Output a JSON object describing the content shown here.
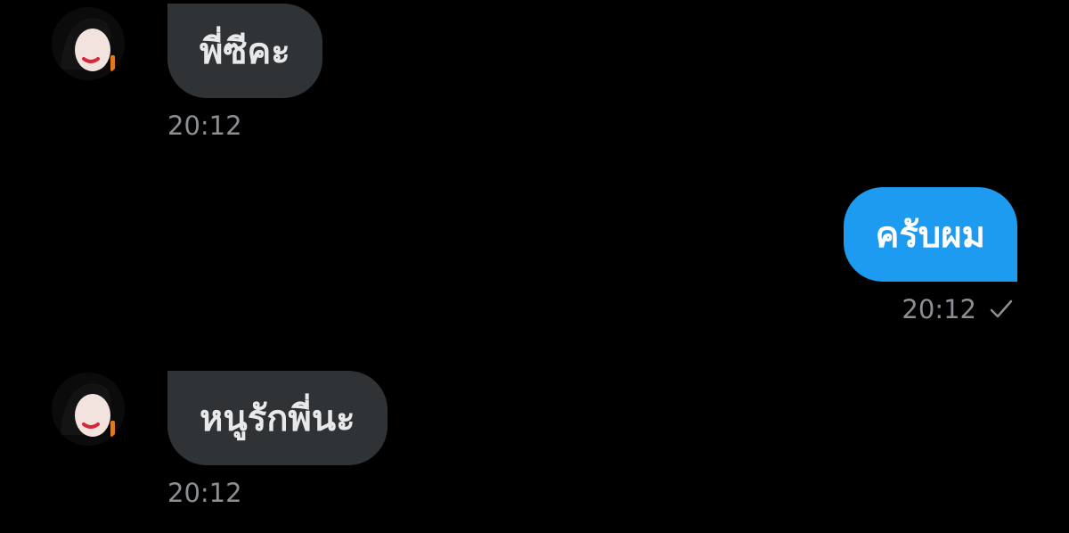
{
  "colors": {
    "background": "#000000",
    "incoming_bubble": "#2f3336",
    "outgoing_bubble": "#1d9bf0",
    "timestamp": "#8b8f93"
  },
  "messages": [
    {
      "direction": "incoming",
      "text": "พี่ซีคะ",
      "time": "20:12",
      "avatar_icon": "avatar-icon"
    },
    {
      "direction": "outgoing",
      "text": "ครับผม",
      "time": "20:12",
      "status_icon": "check-icon"
    },
    {
      "direction": "incoming",
      "text": "หนูรักพี่นะ",
      "time": "20:12",
      "avatar_icon": "avatar-icon"
    }
  ]
}
